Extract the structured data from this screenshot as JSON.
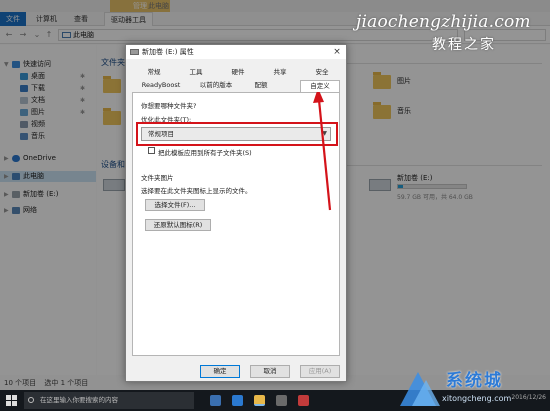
{
  "explorer": {
    "context_tab": "管理",
    "window_title": "此电脑",
    "ribbon_tabs": [
      "文件",
      "计算机",
      "查看",
      "驱动器工具"
    ],
    "address": "此电脑",
    "status": {
      "items": "10 个项目",
      "selected": "选中 1 个项目"
    }
  },
  "nav": {
    "quick_access": "快速访问",
    "items": [
      "桌面",
      "下载",
      "文档",
      "图片",
      "视频",
      "音乐"
    ],
    "onedrive": "OneDrive",
    "this_pc": "此电脑",
    "new_volume": "新加卷 (E:)",
    "network": "网络"
  },
  "content": {
    "folders_header": "文件夹 (",
    "folders_right": [
      "图片",
      "音乐"
    ],
    "devices_header": "设备和",
    "drive": {
      "name": "新加卷 (E:)",
      "used_fraction": 0.08,
      "sub": "59.7 GB 可用，共 64.0 GB"
    }
  },
  "dialog": {
    "title": "新加卷 (E:) 属性",
    "close": "×",
    "tabs_row1": [
      "常规",
      "工具",
      "硬件",
      "共享",
      "安全"
    ],
    "tabs_row2": [
      "ReadyBoost",
      "以前的版本",
      "配额",
      "自定义"
    ],
    "question": "你想要哪种文件夹?",
    "optimize_label": "优化此文件夹(T):",
    "optimize_value": "常规项目",
    "apply_subfolders": "把此模板应用到所有子文件夹(S)",
    "folder_images_label": "文件夹图片",
    "folder_images_desc": "选择要在此文件夹图标上显示的文件。",
    "choose_file": "选择文件(F)...",
    "restore_default": "还原默认图标(R)",
    "ok": "确定",
    "cancel": "取消",
    "apply": "应用(A)"
  },
  "taskbar": {
    "search_placeholder": "在这里输入你要搜索的内容",
    "tray_date": "2016/12/26"
  },
  "watermark": {
    "url": "jiaochengzhijia.com",
    "name": "教程之家",
    "logo_text": "系统城",
    "logo_sub": "xitongcheng.com"
  },
  "colors": {
    "accent": "#1a73c9",
    "highlight": "#d4131a",
    "folder": "#f0c75e",
    "taskbar": "#14181d"
  }
}
